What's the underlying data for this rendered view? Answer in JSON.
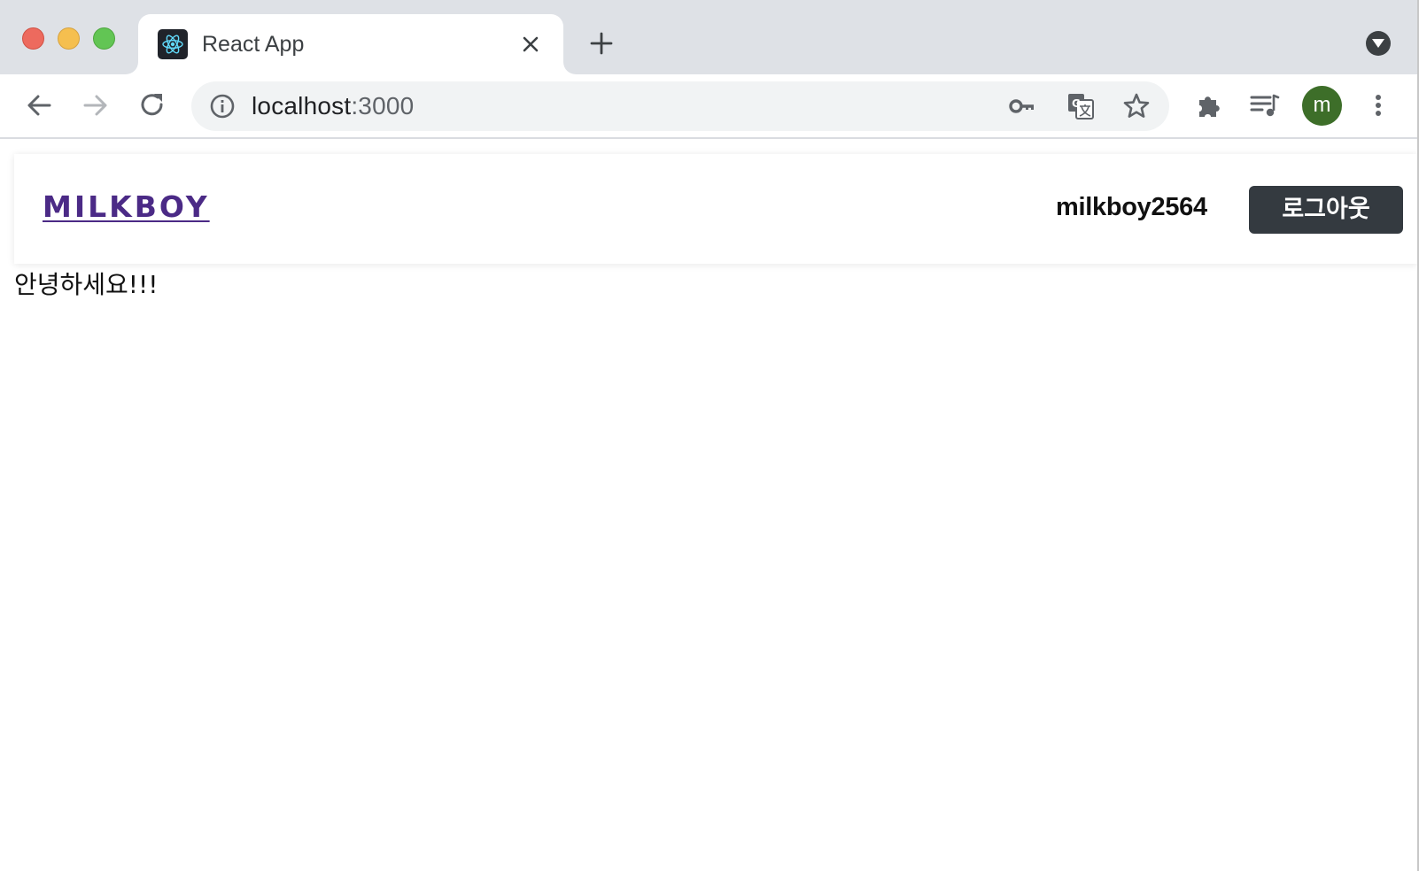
{
  "browser": {
    "tab": {
      "title": "React App",
      "favicon": "react-logo-icon"
    },
    "address_bar": {
      "host": "localhost",
      "port": ":3000"
    },
    "profile_initial": "m",
    "colors": {
      "tabstrip": "#dee1e6",
      "omnibox": "#f1f3f4",
      "avatar": "#3d6e29"
    }
  },
  "app": {
    "brand": "MILKBOY",
    "username": "milkboy2564",
    "logout_label": "로그아웃",
    "greeting": "안녕하세요!!!",
    "colors": {
      "brand": "#4b2a86",
      "logout_button": "#343a40"
    }
  }
}
